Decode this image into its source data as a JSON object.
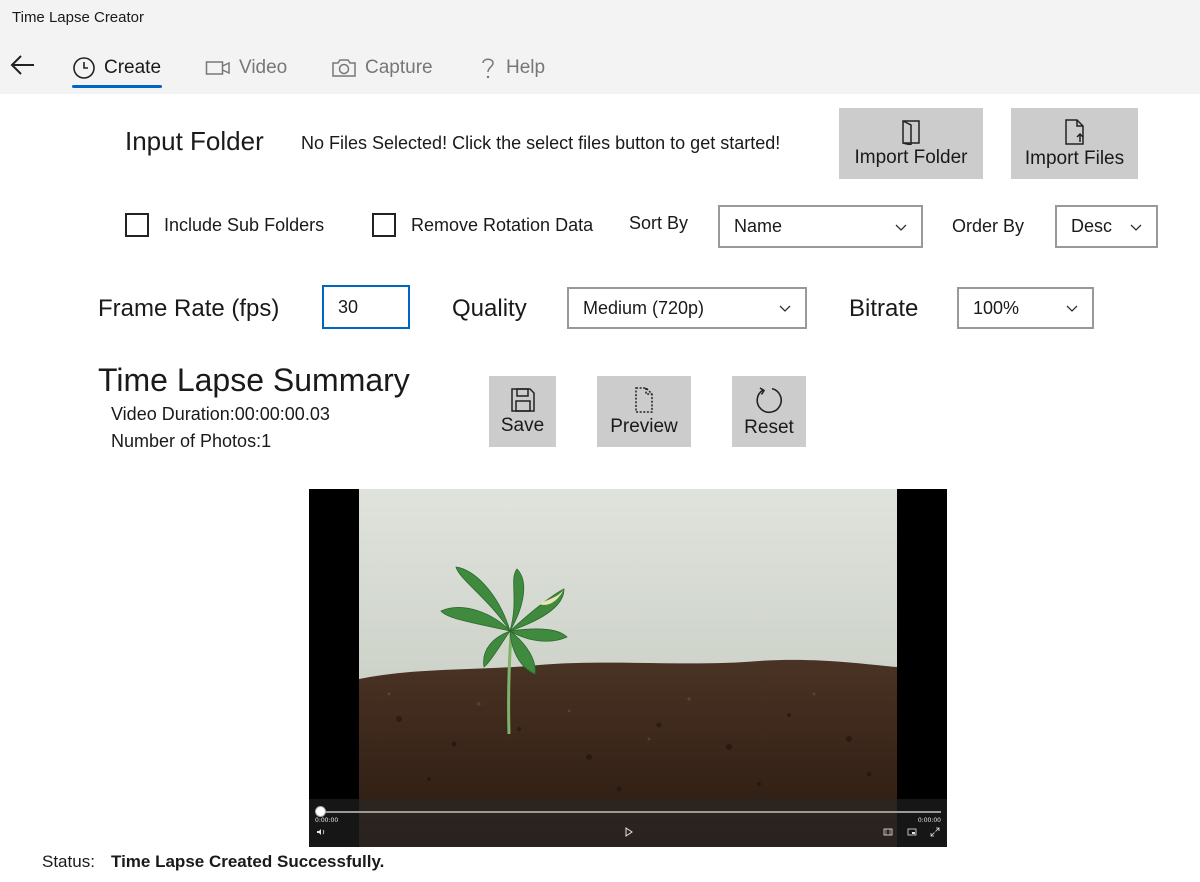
{
  "app": {
    "title": "Time Lapse Creator"
  },
  "nav": {
    "tabs": [
      {
        "label": "Create",
        "icon": "clock-icon",
        "active": true
      },
      {
        "label": "Video",
        "icon": "video-camera-icon",
        "active": false
      },
      {
        "label": "Capture",
        "icon": "camera-icon",
        "active": false
      },
      {
        "label": "Help",
        "icon": "question-icon",
        "active": false
      }
    ],
    "accent": "#0067c0"
  },
  "input_folder": {
    "heading": "Input Folder",
    "message": "No Files Selected! Click the select files button to get started!",
    "import_folder_label": "Import Folder",
    "import_files_label": "Import Files"
  },
  "options": {
    "include_sub_folders_label": "Include Sub Folders",
    "include_sub_folders_checked": false,
    "remove_rotation_label": "Remove Rotation Data",
    "remove_rotation_checked": false,
    "sort_by_label": "Sort By",
    "sort_by_value": "Name",
    "order_by_label": "Order By",
    "order_by_value": "Desc"
  },
  "settings": {
    "frame_rate_label": "Frame Rate (fps)",
    "frame_rate_value": "30",
    "quality_label": "Quality",
    "quality_value": "Medium (720p)",
    "bitrate_label": "Bitrate",
    "bitrate_value": "100%"
  },
  "summary": {
    "heading": "Time Lapse Summary",
    "duration_text": "Video Duration:00:00:00.03",
    "photos_text": "Number of Photos:1",
    "save_label": "Save",
    "preview_label": "Preview",
    "reset_label": "Reset"
  },
  "player": {
    "time_current": "0:00:00",
    "time_total": "0:00:00",
    "progress": 0.0
  },
  "status": {
    "label": "Status:",
    "value": "Time Lapse Created Successfully."
  }
}
